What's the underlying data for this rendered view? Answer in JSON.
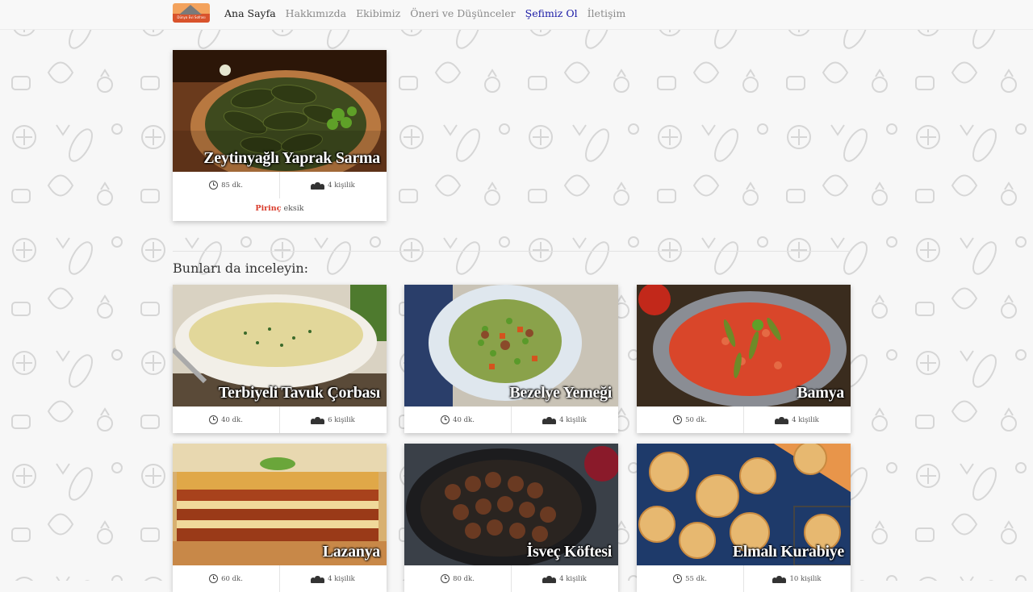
{
  "nav": {
    "logo_text": "Dünya Evi Sofrası",
    "items": [
      {
        "label": "Ana Sayfa",
        "state": "active"
      },
      {
        "label": "Hakkımızda",
        "state": "normal"
      },
      {
        "label": "Ekibimiz",
        "state": "normal"
      },
      {
        "label": "Öneri ve Düşünceler",
        "state": "normal"
      },
      {
        "label": "Şefimiz Ol",
        "state": "highlight"
      },
      {
        "label": "İletişim",
        "state": "normal"
      }
    ]
  },
  "featured": {
    "title": "Zeytinyağlı Yaprak Sarma",
    "time": "85 dk.",
    "servings": "4 kişilik",
    "missing_item": "Pirinç",
    "missing_text": "eksik"
  },
  "suggestions_title": "Bunları da inceleyin:",
  "recipes": [
    {
      "title": "Terbiyeli Tavuk Çorbası",
      "time": "40 dk.",
      "servings": "6 kişilik"
    },
    {
      "title": "Bezelye Yemeği",
      "time": "40 dk.",
      "servings": "4 kişilik"
    },
    {
      "title": "Bamya",
      "time": "50 dk.",
      "servings": "4 kişilik"
    },
    {
      "title": "Lazanya",
      "time": "60 dk.",
      "servings": "4 kişilik"
    },
    {
      "title": "İsveç Köftesi",
      "time": "80 dk.",
      "servings": "4 kişilik"
    },
    {
      "title": "Elmalı Kurabiye",
      "time": "55 dk.",
      "servings": "10 kişilik"
    }
  ],
  "colors": {
    "accent_link": "#1a1aa6",
    "missing_highlight": "#d93a2a",
    "background": "#f7f7f7"
  }
}
